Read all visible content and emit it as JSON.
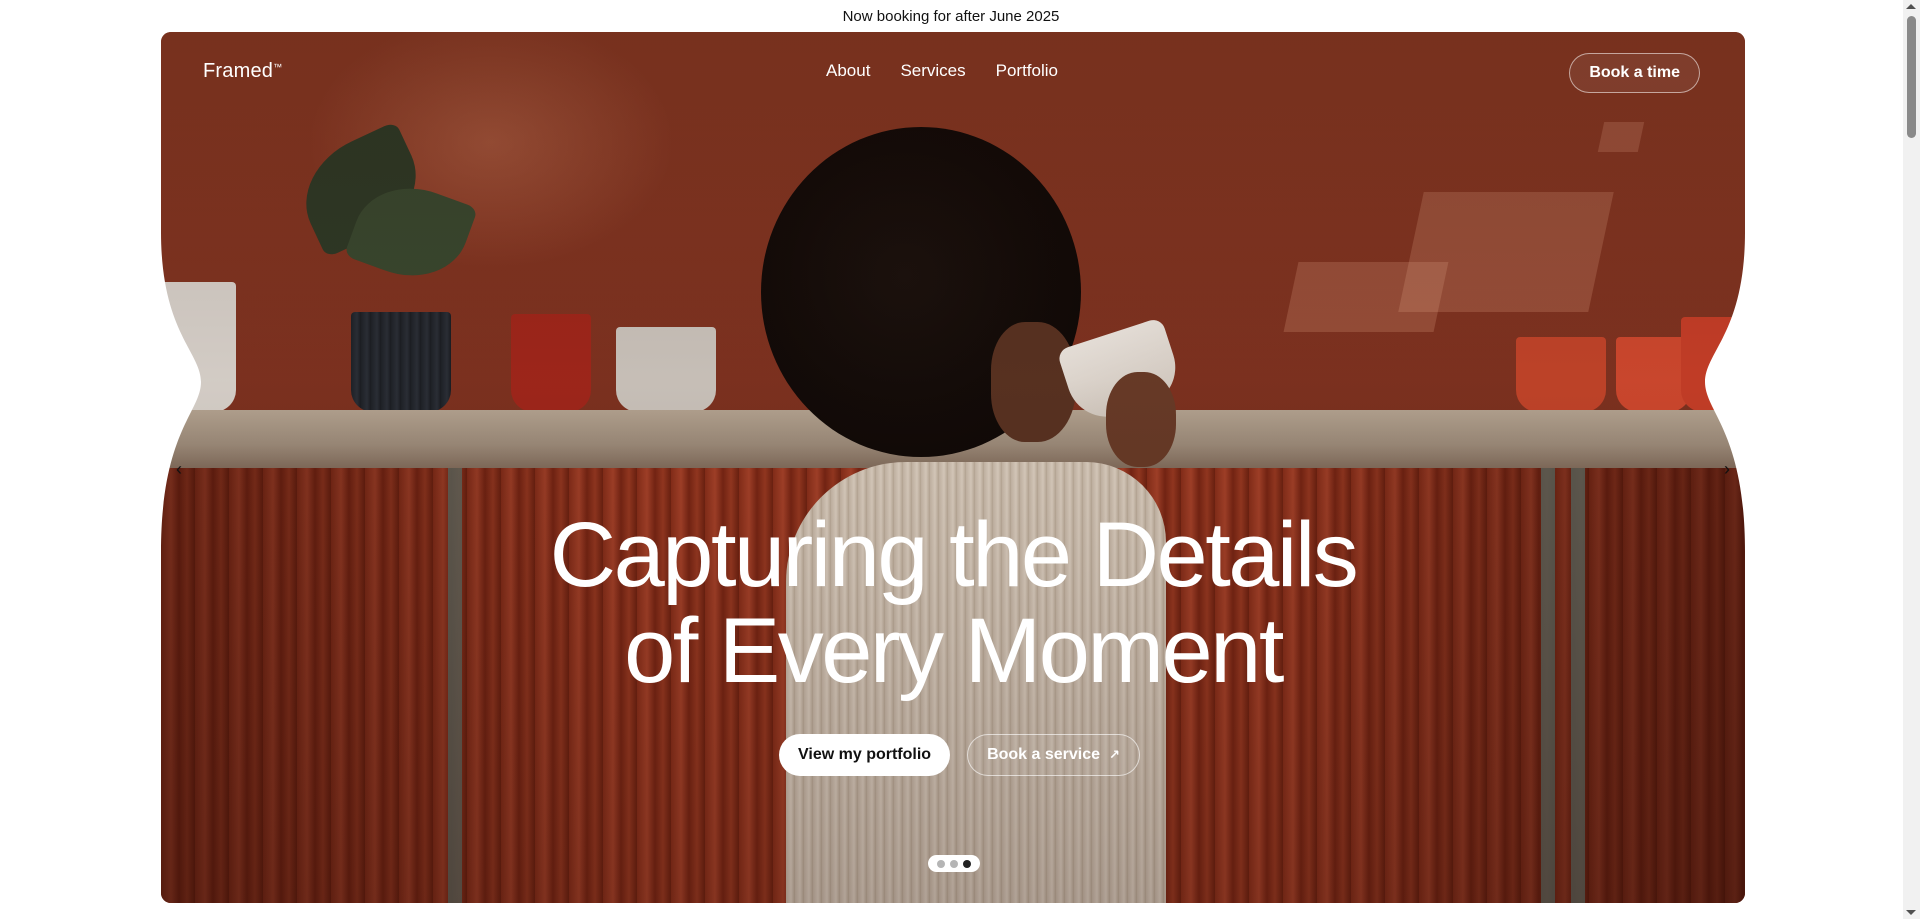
{
  "announcement": {
    "text": "Now booking for after June 2025"
  },
  "brand": {
    "name": "Framed",
    "mark": "™"
  },
  "nav": {
    "items": [
      {
        "label": "About"
      },
      {
        "label": "Services"
      },
      {
        "label": "Portfolio"
      }
    ]
  },
  "header": {
    "cta_label": "Book a time"
  },
  "hero": {
    "headline_line1": "Capturing the Details",
    "headline_line2": "of Every Moment",
    "primary_cta": "View my portfolio",
    "secondary_cta": "Book a service",
    "secondary_cta_icon": "↗"
  },
  "carousel": {
    "prev_icon": "‹",
    "next_icon": "›",
    "slide_count": 3,
    "active_slide": 3
  },
  "colors": {
    "accent": "#8a3a22",
    "text_on_image": "#ffffff",
    "page_bg": "#ffffff"
  }
}
